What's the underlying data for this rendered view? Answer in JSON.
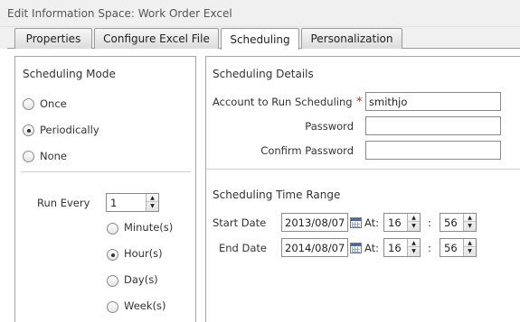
{
  "window": {
    "title": "Edit Information Space: Work Order Excel"
  },
  "tabs": [
    {
      "label": "Properties"
    },
    {
      "label": "Configure Excel File"
    },
    {
      "label": "Scheduling",
      "active": true
    },
    {
      "label": "Personalization"
    }
  ],
  "scheduling_mode": {
    "title": "Scheduling Mode",
    "options": [
      {
        "label": "Once",
        "checked": false
      },
      {
        "label": "Periodically",
        "checked": true
      },
      {
        "label": "None",
        "checked": false
      }
    ],
    "run_every": {
      "label": "Run Every",
      "value": "1",
      "units": [
        {
          "label": "Minute(s)",
          "checked": false
        },
        {
          "label": "Hour(s)",
          "checked": true
        },
        {
          "label": "Day(s)",
          "checked": false
        },
        {
          "label": "Week(s)",
          "checked": false
        }
      ]
    }
  },
  "details": {
    "title": "Scheduling Details",
    "account_label": "Account to Run Scheduling",
    "required_marker": "*",
    "account_value": "smithjo",
    "password_label": "Password",
    "password_value": "",
    "confirm_label": "Confirm Password",
    "confirm_value": ""
  },
  "time_range": {
    "title": "Scheduling Time Range",
    "at_label": "At:",
    "colon": ":",
    "start": {
      "label": "Start Date",
      "date": "2013/08/07",
      "hour": "16",
      "minute": "56"
    },
    "end": {
      "label": "End Date",
      "date": "2014/08/07",
      "hour": "16",
      "minute": "56"
    }
  },
  "icons": {
    "calendar": "calendar-icon",
    "spin_up": "▲",
    "spin_down": "▼"
  },
  "colors": {
    "required": "#d02020",
    "tab_border": "#9a9a9a",
    "panel_border": "#a6a6a6"
  }
}
